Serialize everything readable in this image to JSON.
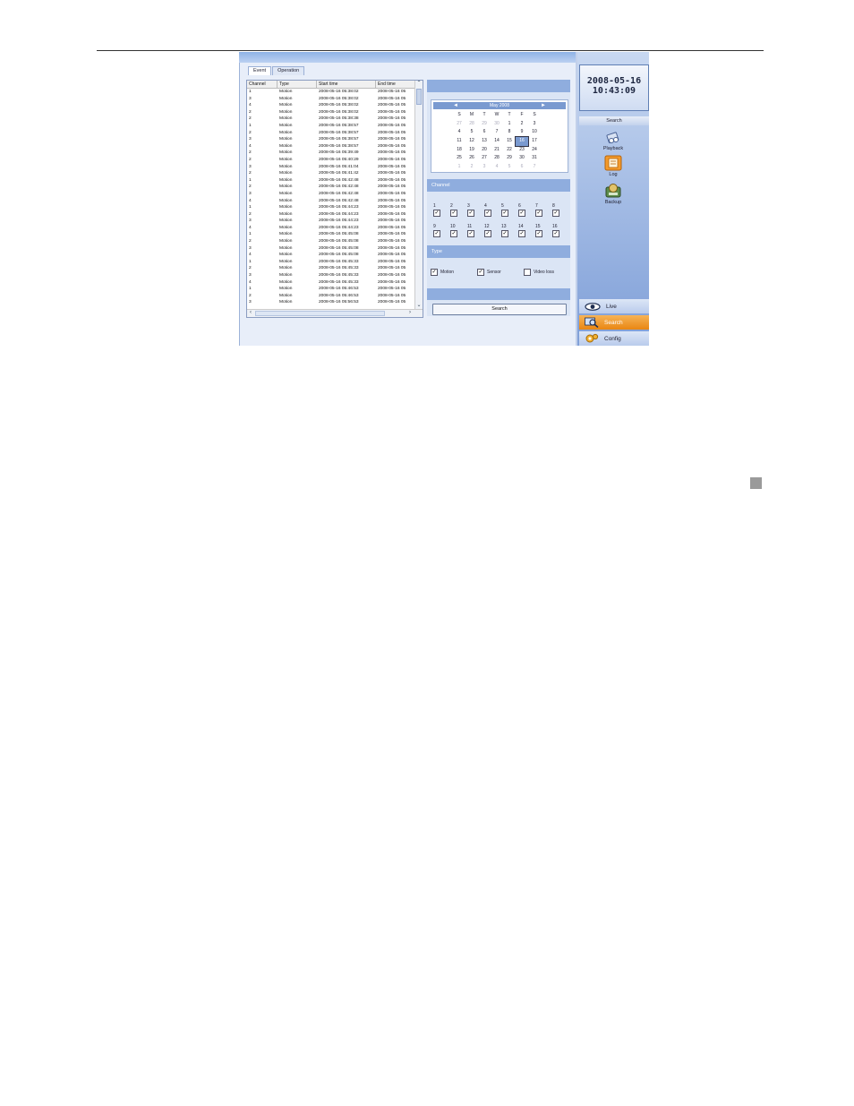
{
  "clock": {
    "date": "2008-05-16",
    "time": "10:43:09"
  },
  "tabs": [
    {
      "label": "Event"
    },
    {
      "label": "Operation"
    }
  ],
  "table": {
    "columns": [
      "Channel",
      "Type",
      "Start time",
      "End time"
    ],
    "rows": [
      [
        "1",
        "Motion",
        "2008-05-16 05:38:02",
        "2008-05-16 05"
      ],
      [
        "3",
        "Motion",
        "2008-05-16 05:38:02",
        "2008-05-16 05"
      ],
      [
        "4",
        "Motion",
        "2008-05-16 05:38:02",
        "2008-05-16 05"
      ],
      [
        "2",
        "Motion",
        "2008-05-16 05:38:02",
        "2008-05-16 05"
      ],
      [
        "2",
        "Motion",
        "2008-05-16 05:38:38",
        "2008-05-16 05"
      ],
      [
        "1",
        "Motion",
        "2008-05-16 05:38:57",
        "2008-05-16 05"
      ],
      [
        "2",
        "Motion",
        "2008-05-16 05:38:57",
        "2008-05-16 05"
      ],
      [
        "3",
        "Motion",
        "2008-05-16 05:38:57",
        "2008-05-16 05"
      ],
      [
        "4",
        "Motion",
        "2008-05-16 05:38:57",
        "2008-05-16 05"
      ],
      [
        "2",
        "Motion",
        "2008-05-16 05:39:49",
        "2008-05-16 05"
      ],
      [
        "2",
        "Motion",
        "2008-05-16 05:40:29",
        "2008-05-16 05"
      ],
      [
        "3",
        "Motion",
        "2008-05-16 05:41:04",
        "2008-05-16 05"
      ],
      [
        "2",
        "Motion",
        "2008-05-16 05:41:42",
        "2008-05-16 05"
      ],
      [
        "1",
        "Motion",
        "2008-05-16 05:42:48",
        "2008-05-16 05"
      ],
      [
        "2",
        "Motion",
        "2008-05-16 05:42:48",
        "2008-05-16 05"
      ],
      [
        "3",
        "Motion",
        "2008-05-16 05:42:48",
        "2008-05-16 05"
      ],
      [
        "4",
        "Motion",
        "2008-05-16 05:42:48",
        "2008-05-16 05"
      ],
      [
        "1",
        "Motion",
        "2008-05-16 05:44:23",
        "2008-05-16 05"
      ],
      [
        "2",
        "Motion",
        "2008-05-16 05:44:23",
        "2008-05-16 05"
      ],
      [
        "3",
        "Motion",
        "2008-05-16 05:44:23",
        "2008-05-16 05"
      ],
      [
        "4",
        "Motion",
        "2008-05-16 05:44:23",
        "2008-05-16 05"
      ],
      [
        "1",
        "Motion",
        "2008-05-16 05:45:08",
        "2008-05-16 05"
      ],
      [
        "2",
        "Motion",
        "2008-05-16 05:45:08",
        "2008-05-16 05"
      ],
      [
        "3",
        "Motion",
        "2008-05-16 05:45:08",
        "2008-05-16 05"
      ],
      [
        "4",
        "Motion",
        "2008-05-16 05:45:08",
        "2008-05-16 05"
      ],
      [
        "1",
        "Motion",
        "2008-05-16 05:45:33",
        "2008-05-16 05"
      ],
      [
        "2",
        "Motion",
        "2008-05-16 05:45:33",
        "2008-05-16 05"
      ],
      [
        "3",
        "Motion",
        "2008-05-16 05:45:33",
        "2008-05-16 05"
      ],
      [
        "4",
        "Motion",
        "2008-05-16 05:45:33",
        "2008-05-16 05"
      ],
      [
        "1",
        "Motion",
        "2008-05-16 05:46:53",
        "2008-05-16 05"
      ],
      [
        "2",
        "Motion",
        "2008-05-16 05:46:53",
        "2008-05-16 05"
      ],
      [
        "3",
        "Motion",
        "2008-05-16 05:56:53",
        "2008-05-16 05"
      ]
    ]
  },
  "calendar": {
    "month_label": "May 2008",
    "prev": "◄",
    "next": "►",
    "weekdays": [
      "S",
      "M",
      "T",
      "W",
      "T",
      "F",
      "S"
    ],
    "weeks": [
      [
        "27",
        "28",
        "29",
        "30",
        "1",
        "2",
        "3"
      ],
      [
        "4",
        "5",
        "6",
        "7",
        "8",
        "9",
        "10"
      ],
      [
        "11",
        "12",
        "13",
        "14",
        "15",
        "16",
        "17"
      ],
      [
        "18",
        "19",
        "20",
        "21",
        "22",
        "23",
        "24"
      ],
      [
        "25",
        "26",
        "27",
        "28",
        "29",
        "30",
        "31"
      ],
      [
        "1",
        "2",
        "3",
        "4",
        "5",
        "6",
        "7"
      ]
    ],
    "selected_day": "16"
  },
  "channel": {
    "label": "Channel",
    "row1": [
      "1",
      "2",
      "3",
      "4",
      "5",
      "6",
      "7",
      "8"
    ],
    "row2": [
      "9",
      "10",
      "11",
      "12",
      "13",
      "14",
      "15",
      "16"
    ]
  },
  "type": {
    "label": "Type",
    "items": [
      {
        "label": "Motion",
        "checked": true
      },
      {
        "label": "Sensor",
        "checked": true
      },
      {
        "label": "Video loss",
        "checked": false
      }
    ]
  },
  "search_button": "Search",
  "sidebar": {
    "section_label": "Search",
    "tools": [
      {
        "label": "Playback"
      },
      {
        "label": "Log"
      },
      {
        "label": "Backup"
      }
    ]
  },
  "nav": {
    "live": "Live",
    "search": "Search",
    "config": "Config"
  },
  "check_mark": "✓",
  "colors": {
    "accent_orange": "#e98612",
    "panel_blue": "#8fadde",
    "selected_day": "#7a9ad0"
  }
}
